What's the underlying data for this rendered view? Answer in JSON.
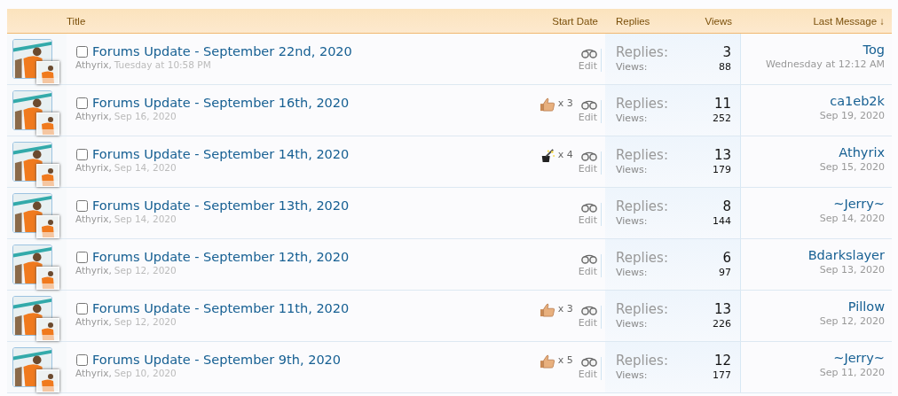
{
  "columns": {
    "title": "Title",
    "start_date": "Start Date",
    "replies": "Replies",
    "views": "Views",
    "last_message": "Last Message ↓"
  },
  "threads": [
    {
      "title": "Forums Update - September 22nd, 2020",
      "checked": false,
      "author": "Athyrix,",
      "date": "Tuesday at 10:58 PM",
      "edit": "Edit",
      "replies_label": "Replies:",
      "replies": "3",
      "views_label": "Views:",
      "views": "88",
      "last_user": "Tog",
      "last_date": "Wednesday at 12:12 AM"
    },
    {
      "title": "Forums Update - September 16th, 2020",
      "checked": false,
      "author": "Athyrix,",
      "date": "Sep 16, 2020",
      "reactions": [
        {
          "kind": "like",
          "count": "x 3"
        }
      ],
      "edit": "Edit",
      "replies_label": "Replies:",
      "replies": "11",
      "views_label": "Views:",
      "views": "252",
      "last_user": "ca1eb2k",
      "last_date": "Sep 19, 2020"
    },
    {
      "title": "Forums Update - September 14th, 2020",
      "checked": false,
      "author": "Athyrix,",
      "date": "Sep 14, 2020",
      "reactions": [
        {
          "kind": "magic",
          "count": "x 4"
        }
      ],
      "edit": "Edit",
      "replies_label": "Replies:",
      "replies": "13",
      "views_label": "Views:",
      "views": "179",
      "last_user": "Athyrix",
      "last_date": "Sep 15, 2020"
    },
    {
      "title": "Forums Update - September 13th, 2020",
      "checked": false,
      "author": "Athyrix,",
      "date": "Sep 14, 2020",
      "edit": "Edit",
      "replies_label": "Replies:",
      "replies": "8",
      "views_label": "Views:",
      "views": "144",
      "last_user": "~Jerry~",
      "last_date": "Sep 14, 2020"
    },
    {
      "title": "Forums Update - September 12th, 2020",
      "checked": false,
      "author": "Athyrix,",
      "date": "Sep 12, 2020",
      "edit": "Edit",
      "replies_label": "Replies:",
      "replies": "6",
      "views_label": "Views:",
      "views": "97",
      "last_user": "Bdarkslayer",
      "last_date": "Sep 13, 2020"
    },
    {
      "title": "Forums Update - September 11th, 2020",
      "checked": false,
      "author": "Athyrix,",
      "date": "Sep 12, 2020",
      "reactions": [
        {
          "kind": "like",
          "count": "x 3"
        }
      ],
      "edit": "Edit",
      "replies_label": "Replies:",
      "replies": "13",
      "views_label": "Views:",
      "views": "226",
      "last_user": "Pillow",
      "last_date": "Sep 12, 2020"
    },
    {
      "title": "Forums Update - September 9th, 2020",
      "checked": false,
      "author": "Athyrix,",
      "date": "Sep 10, 2020",
      "reactions": [
        {
          "kind": "like",
          "count": "x 5"
        }
      ],
      "edit": "Edit",
      "replies_label": "Replies:",
      "replies": "12",
      "views_label": "Views:",
      "views": "177",
      "last_user": "~Jerry~",
      "last_date": "Sep 11, 2020"
    }
  ]
}
